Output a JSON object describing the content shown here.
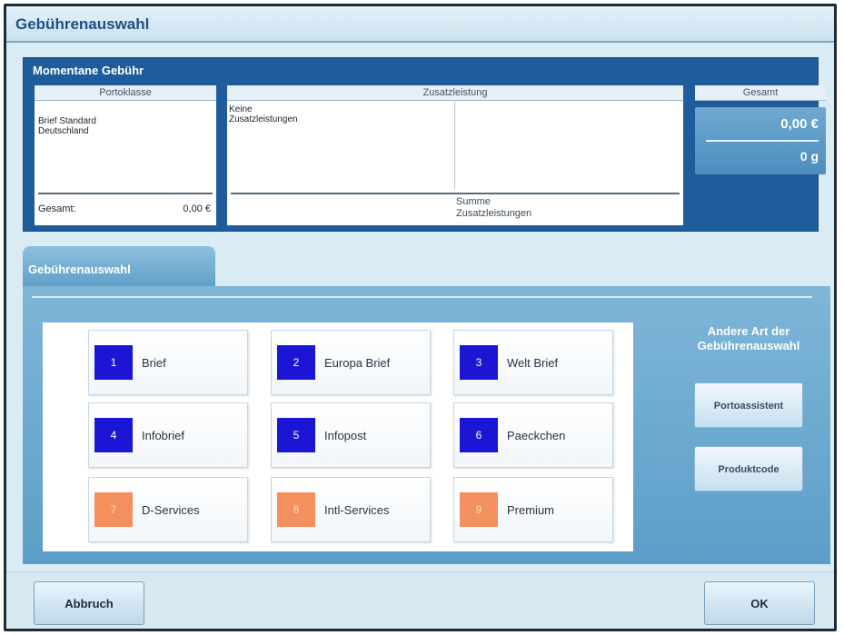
{
  "window": {
    "title": "Gebührenauswahl"
  },
  "current_fee": {
    "header": "Momentane Gebühr",
    "postage_class": {
      "header": "Portoklasse",
      "value_line1": "Brief Standard",
      "value_line2": "Deutschland",
      "total_label": "Gesamt:",
      "total_value": "0,00 €"
    },
    "extra_services": {
      "header": "Zusatzleistung",
      "value_line1": "Keine",
      "value_line2": "Zusatzleistungen",
      "sum_line1": "Summe",
      "sum_line2": "Zusatzleistungen"
    },
    "total": {
      "header": "Gesamt",
      "amount": "0,00 €",
      "weight": "0 g"
    }
  },
  "selection": {
    "tab_label": "Gebührenauswahl",
    "buttons": [
      {
        "number": "1",
        "label": "Brief",
        "color": "#1a16d4"
      },
      {
        "number": "2",
        "label": "Europa Brief",
        "color": "#1a16d4"
      },
      {
        "number": "3",
        "label": "Welt Brief",
        "color": "#1a16d4"
      },
      {
        "number": "4",
        "label": "Infobrief",
        "color": "#1a16d4"
      },
      {
        "number": "5",
        "label": "Infopost",
        "color": "#1a16d4"
      },
      {
        "number": "6",
        "label": "Paeckchen",
        "color": "#1a16d4"
      },
      {
        "number": "7",
        "label": "D-Services",
        "color": "#f4905e"
      },
      {
        "number": "8",
        "label": "Intl-Services",
        "color": "#f4905e"
      },
      {
        "number": "9",
        "label": "Premium",
        "color": "#f4905e"
      }
    ],
    "other_header_line1": "Andere Art der",
    "other_header_line2": "Gebührenauswahl",
    "porto_assistant": "Portoassistent",
    "product_code": "Produktcode"
  },
  "footer": {
    "cancel": "Abbruch",
    "ok": "OK"
  }
}
